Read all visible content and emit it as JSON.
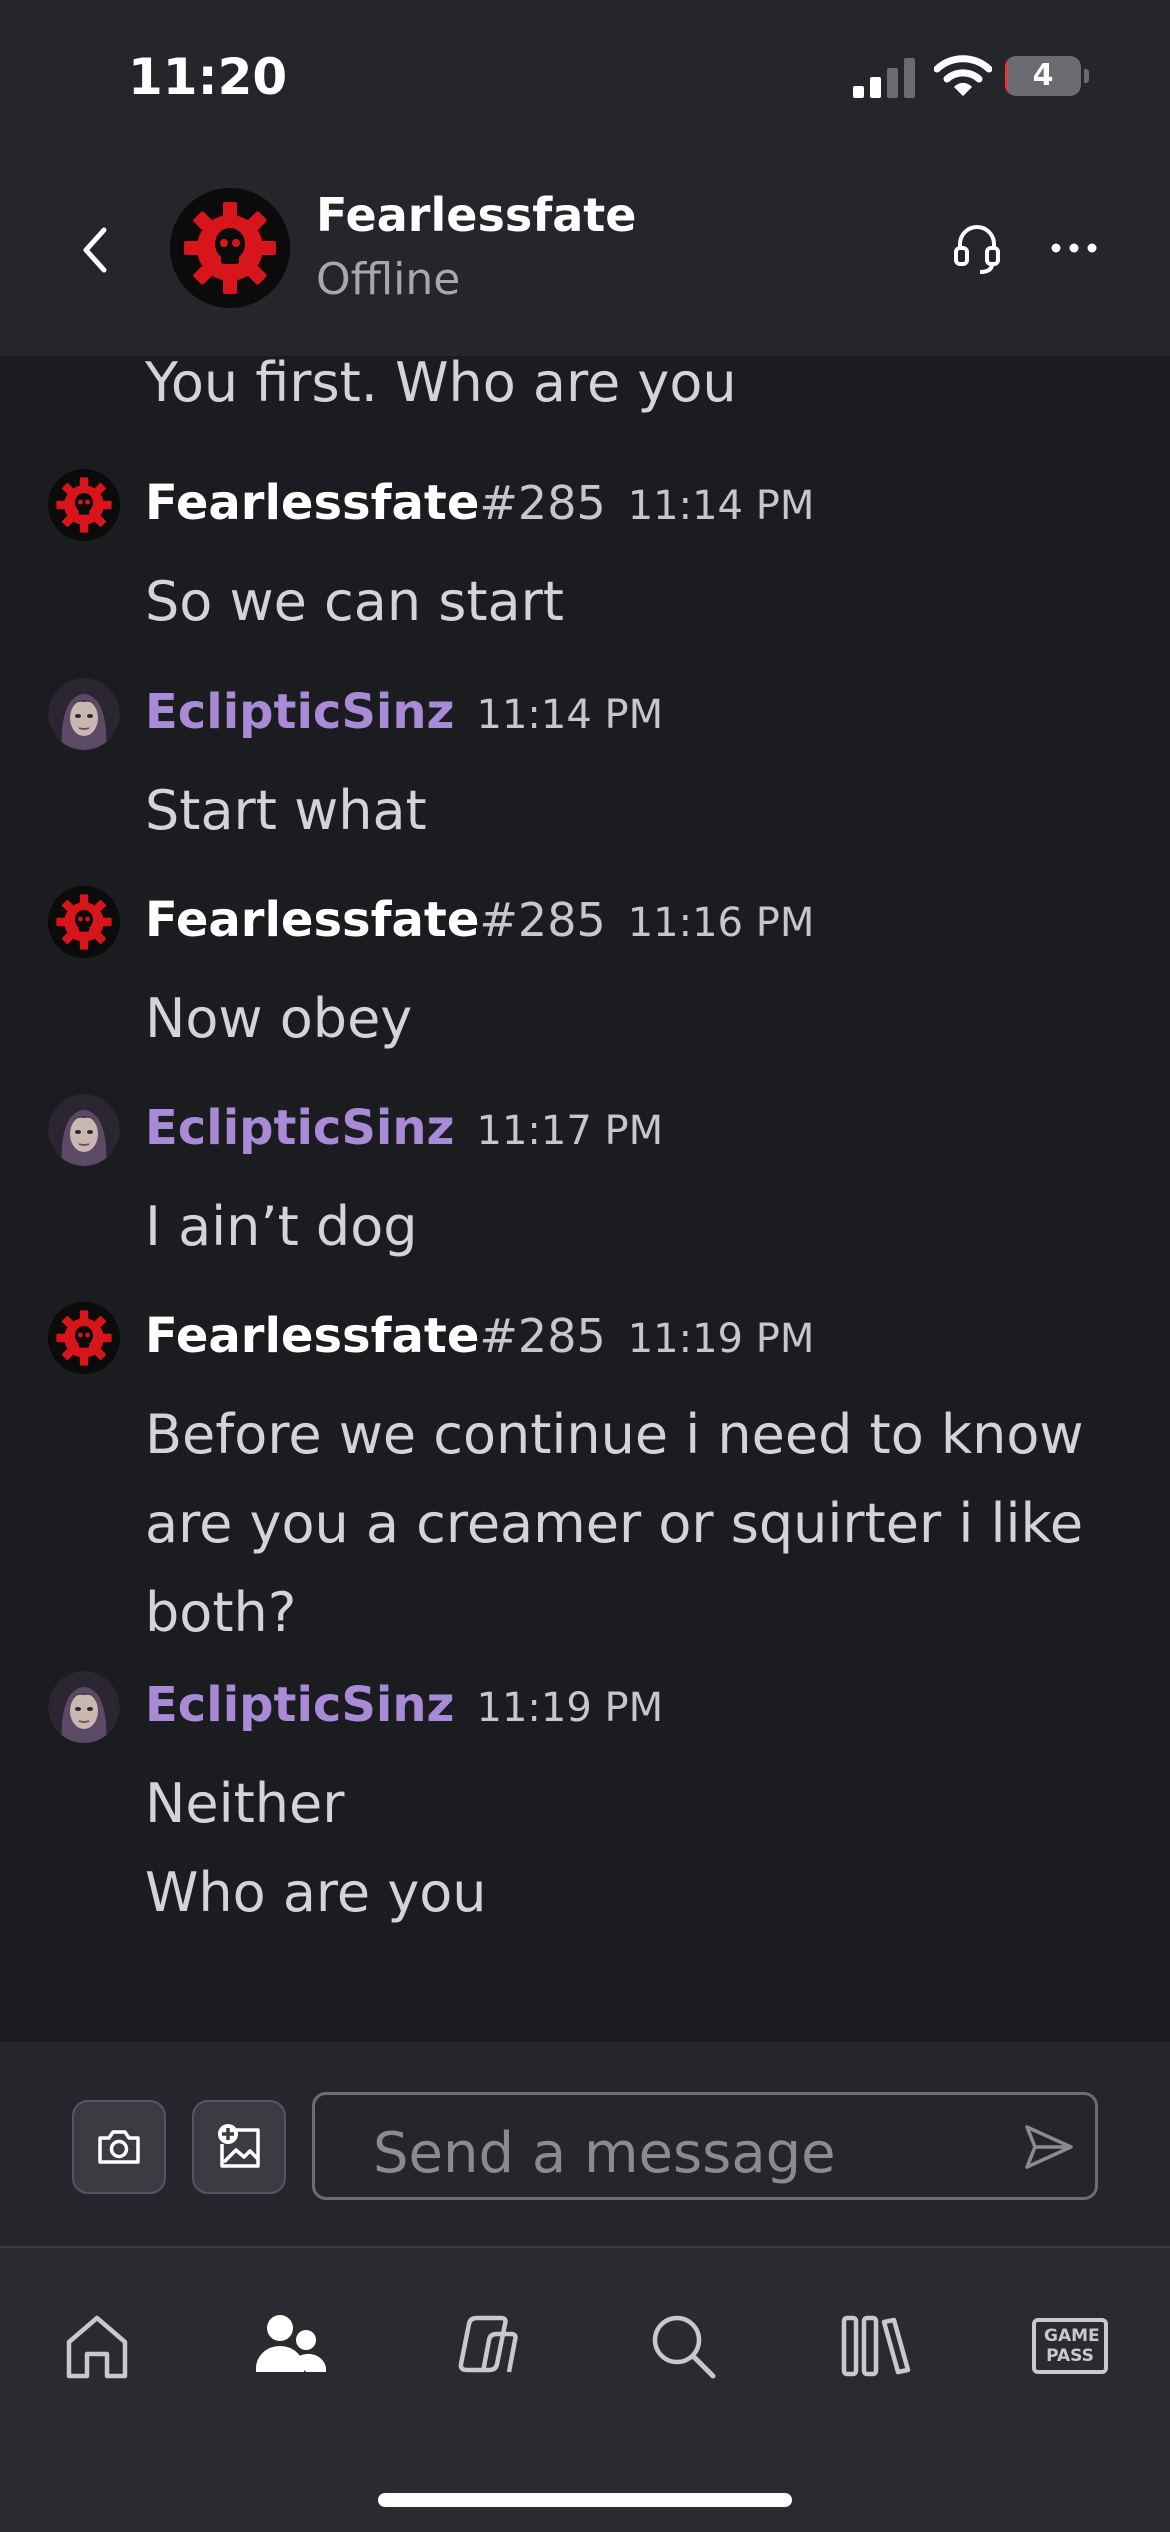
{
  "status_bar": {
    "time": "11:20",
    "battery_level": "4",
    "battery_fraction": 0.04,
    "battery_color": "#e23b3b",
    "signal_bars": 2,
    "icons": [
      "signal-icon",
      "wifi-icon",
      "battery-icon"
    ]
  },
  "header": {
    "back_icon": "chevron-left-icon",
    "name": "Fearlessfate",
    "status": "Offline",
    "actions": [
      "headset-icon",
      "more-icon"
    ]
  },
  "conversation": {
    "partial_message": "You first. Who are you",
    "messages": [
      {
        "name": "Fearlessfate",
        "tag": "#285",
        "time": "11:14 PM",
        "lines": [
          "So we can start"
        ],
        "sender": "fearlessfate"
      },
      {
        "name": "EclipticSinz",
        "tag": "",
        "time": "11:14 PM",
        "lines": [
          "Start what"
        ],
        "sender": "eclipticsinz"
      },
      {
        "name": "Fearlessfate",
        "tag": "#285",
        "time": "11:16 PM",
        "lines": [
          "Now obey"
        ],
        "sender": "fearlessfate"
      },
      {
        "name": "EclipticSinz",
        "tag": "",
        "time": "11:17 PM",
        "lines": [
          "I ain’t dog"
        ],
        "sender": "eclipticsinz"
      },
      {
        "name": "Fearlessfate",
        "tag": "#285",
        "time": "11:19 PM",
        "lines": [
          "Before we continue i need to know",
          "are you a creamer or squirter i like",
          "both?"
        ],
        "sender": "fearlessfate"
      },
      {
        "name": "EclipticSinz",
        "tag": "",
        "time": "11:19 PM",
        "lines": [
          "Neither",
          "Who are you"
        ],
        "sender": "eclipticsinz"
      }
    ]
  },
  "composer": {
    "placeholder": "Send a message",
    "camera_icon": "camera-icon",
    "image_icon": "add-image-icon",
    "send_icon": "send-icon"
  },
  "bottom_nav": {
    "items": [
      {
        "icon": "home-icon",
        "active": false
      },
      {
        "icon": "friends-icon",
        "active": true
      },
      {
        "icon": "xbox-store-icon",
        "active": false
      },
      {
        "icon": "search-icon",
        "active": false
      },
      {
        "icon": "library-icon",
        "active": false
      },
      {
        "icon": "game-pass-icon",
        "label": "GAME PASS",
        "active": false
      }
    ]
  },
  "colors": {
    "background": "#1b1c20",
    "header": "#24262b",
    "accent_purple": "#a98ad6",
    "nav": "#2a2b2f"
  }
}
